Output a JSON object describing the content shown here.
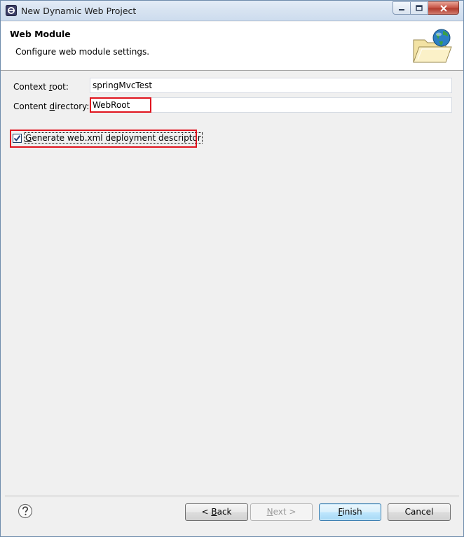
{
  "window": {
    "title": "New Dynamic Web Project"
  },
  "banner": {
    "title": "Web Module",
    "description": "Configure web module settings."
  },
  "form": {
    "context_root": {
      "label_pre": "Context ",
      "label_mnemonic": "r",
      "label_post": "oot:",
      "value": "springMvcTest"
    },
    "content_directory": {
      "label_pre": "Content ",
      "label_mnemonic": "d",
      "label_post": "irectory:",
      "value": "WebRoot"
    },
    "generate_descriptor": {
      "mnemonic": "G",
      "label_post": "enerate web.xml deployment descriptor",
      "checked": true
    }
  },
  "buttons": {
    "back": {
      "prefix": "< ",
      "mnemonic": "B",
      "rest": "ack"
    },
    "next": {
      "mnemonic": "N",
      "rest": "ext >"
    },
    "finish": {
      "mnemonic": "F",
      "rest": "inish"
    },
    "cancel": {
      "label": "Cancel"
    }
  },
  "colors": {
    "highlight": "#e0141e",
    "title_bar": "#d7e3f1",
    "dialog_bg": "#f0f0f0"
  }
}
